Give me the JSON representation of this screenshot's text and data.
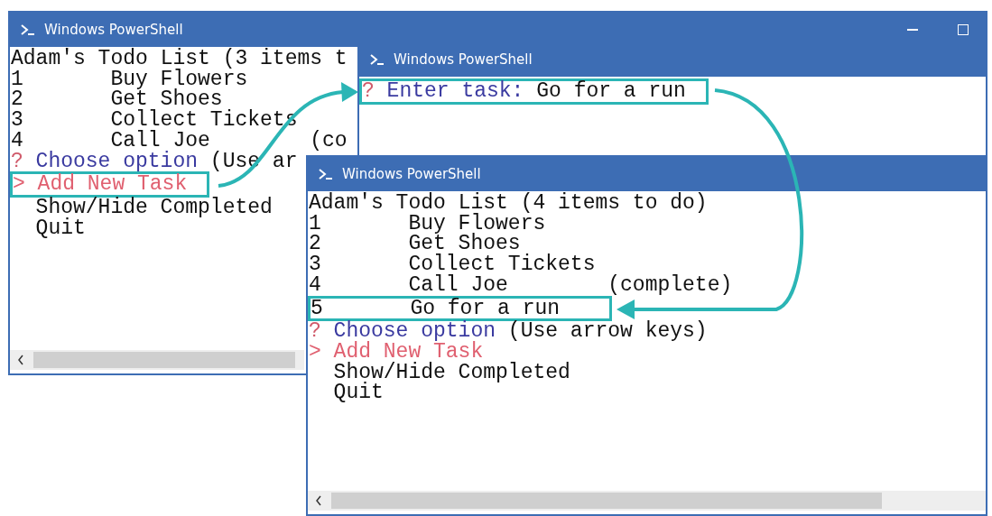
{
  "windows": [
    {
      "title": "Windows PowerShell",
      "caption_buttons": true,
      "heading": "Adam's Todo List (3 items t",
      "scrollbar": true,
      "tasks": [
        {
          "number": "1",
          "task": "Buy Flowers",
          "highlighted": false
        },
        {
          "number": "2",
          "task": "Get Shoes",
          "highlighted": false
        },
        {
          "number": "3",
          "task": "Collect Tickets",
          "highlighted": false
        },
        {
          "number": "4",
          "task": "Call Joe",
          "status": "(co",
          "highlighted": false
        }
      ],
      "prompt": {
        "mark": "?",
        "label": "Choose option",
        "hint": "(Use ar",
        "highlighted": false
      },
      "options": [
        {
          "marker": ">",
          "label": "Add New Task",
          "selected": true,
          "highlighted": true
        },
        {
          "label": "Show/Hide Completed",
          "selected": false,
          "highlighted": false
        },
        {
          "label": "Quit",
          "selected": false,
          "highlighted": false
        }
      ]
    },
    {
      "title": "Windows PowerShell",
      "caption_buttons": false,
      "scrollbar": false,
      "prompt": {
        "mark": "?",
        "label": "Enter task:",
        "value": "Go for a run",
        "highlighted": true
      }
    },
    {
      "title": "Windows PowerShell",
      "caption_buttons": false,
      "heading": "Adam's Todo List (4 items to do)",
      "scrollbar": true,
      "tasks": [
        {
          "number": "1",
          "task": "Buy Flowers",
          "highlighted": false
        },
        {
          "number": "2",
          "task": "Get Shoes",
          "highlighted": false
        },
        {
          "number": "3",
          "task": "Collect Tickets",
          "highlighted": false
        },
        {
          "number": "4",
          "task": "Call Joe",
          "status": "(complete)",
          "highlighted": false
        },
        {
          "number": "5",
          "task": "Go for a run",
          "highlighted": true
        }
      ],
      "prompt": {
        "mark": "?",
        "label": "Choose option",
        "hint": "(Use arrow keys)",
        "highlighted": false
      },
      "options": [
        {
          "marker": ">",
          "label": "Add New Task",
          "selected": true,
          "highlighted": false
        },
        {
          "label": "Show/Hide Completed",
          "selected": false,
          "highlighted": false
        },
        {
          "label": "Quit",
          "selected": false,
          "highlighted": false
        }
      ]
    }
  ]
}
